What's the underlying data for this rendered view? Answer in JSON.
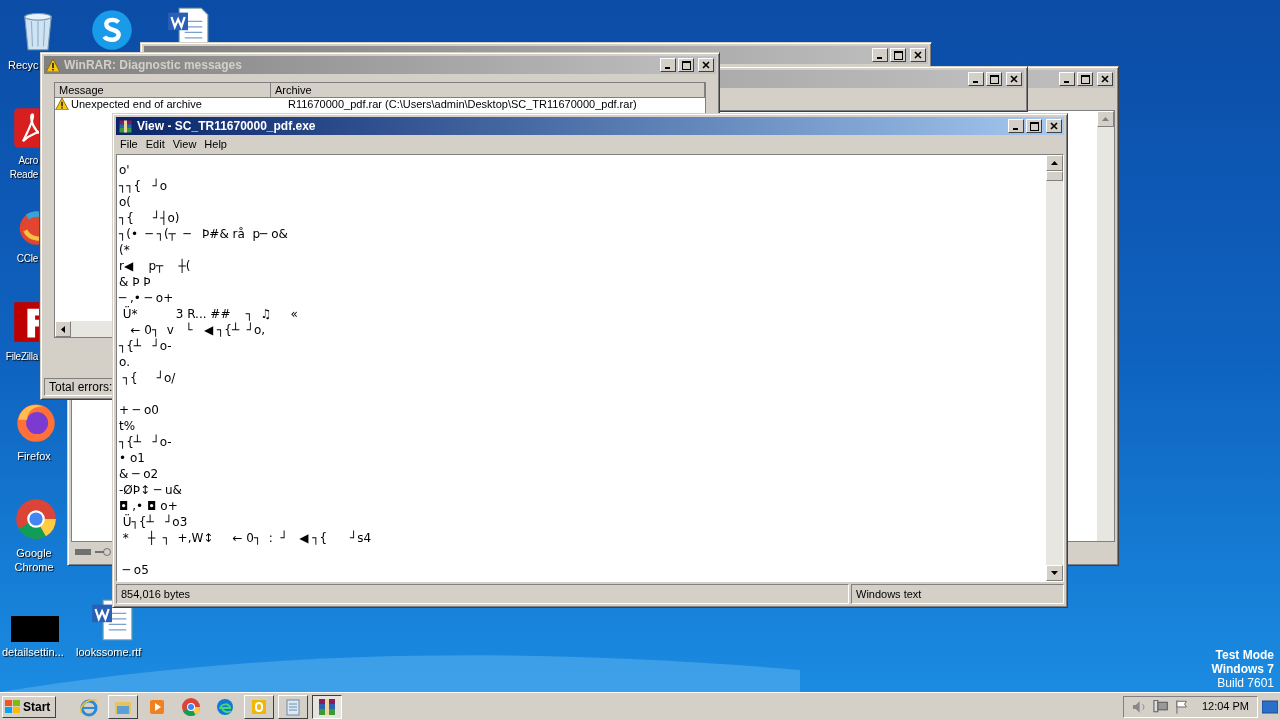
{
  "desktop": {
    "icons": [
      {
        "kind": "recycle-bin",
        "label": "Recyc"
      },
      {
        "kind": "skype"
      },
      {
        "kind": "word"
      },
      {
        "kind": "acrobat",
        "label": "Acro\nReade"
      },
      {
        "kind": "ccleaner",
        "label": "CCle"
      },
      {
        "kind": "filezilla",
        "label": "FileZilla"
      },
      {
        "kind": "firefox",
        "label": "Firefox"
      },
      {
        "kind": "chrome",
        "label": "Google\nChrome"
      },
      {
        "kind": "black-thumb",
        "label": "detailsettin..."
      },
      {
        "kind": "word",
        "label": "lookssome.rtf"
      }
    ],
    "os_notice": [
      "Test Mode",
      "Windows 7",
      "Build 7601"
    ]
  },
  "diagnostic_window": {
    "title": "WinRAR: Diagnostic messages",
    "active": false,
    "columns": [
      "Message",
      "Archive"
    ],
    "rows": [
      {
        "message": "Unexpected end of archive",
        "archive": "R11670000_pdf.rar (C:\\Users\\admin\\Desktop\\SC_TR11670000_pdf.rar)"
      }
    ],
    "status": "Total errors:"
  },
  "viewer_window": {
    "title": "View - SC_TR11670000_pdf.exe",
    "active": true,
    "menu": [
      "File",
      "Edit",
      "View",
      "Help"
    ],
    "lines": [
      {
        "kind": "text",
        "text": "o'"
      },
      {
        "kind": "text",
        "text": "┐┐{   ┘o"
      },
      {
        "kind": "text",
        "text": "o("
      },
      {
        "kind": "text",
        "text": "┐{     ┘┤o)"
      },
      {
        "kind": "text",
        "text": "┐(•  ─ ┐(┬  ─   Þ#& rå  p─ o&"
      },
      {
        "kind": "text",
        "text": "(*"
      },
      {
        "kind": "text",
        "text": "r◀    p┬    ┼("
      },
      {
        "kind": "text",
        "text": "& Þ Þ"
      },
      {
        "kind": "text",
        "text": "─ ,• ─ o+"
      },
      {
        "kind": "text",
        "text": " Ü*          3 R... ##    ┐  ♫     «"
      },
      {
        "kind": "text",
        "text": "   ← 0┐  v   └   ◀ ┐{┴  ┘o,"
      },
      {
        "kind": "text",
        "text": "┐{┴   ┘o-"
      },
      {
        "kind": "text",
        "text": "o."
      },
      {
        "kind": "text",
        "text": " ┐{     ┘o/"
      },
      {
        "kind": "blank"
      },
      {
        "kind": "text",
        "text": "+ ─ o0"
      },
      {
        "kind": "text",
        "text": "t%"
      },
      {
        "kind": "text",
        "text": "┐{┴   ┘o-"
      },
      {
        "kind": "text",
        "text": "• o1"
      },
      {
        "kind": "text",
        "text": "& ─ o2"
      },
      {
        "kind": "text",
        "text": "-ØÞ↕ ─ u&"
      },
      {
        "kind": "text",
        "text": "◘ ,• ◘ o+"
      },
      {
        "kind": "text",
        "text": " Ü┐{┴   ┘o3"
      },
      {
        "kind": "text",
        "text": " *     ┼  ┐  +,W↕     ← 0┐  :  ┘   ◀ ┐{      ┘s4"
      },
      {
        "kind": "blank"
      },
      {
        "kind": "text",
        "text": " ─ o5"
      }
    ],
    "status": [
      "854,016 bytes",
      "Windows text"
    ]
  },
  "taskbar": {
    "start": "Start",
    "apps": [
      {
        "kind": "ie",
        "open": false,
        "selected": false
      },
      {
        "kind": "explorer",
        "open": true,
        "selected": false
      },
      {
        "kind": "media-player",
        "open": false,
        "selected": false
      },
      {
        "kind": "chrome",
        "open": false,
        "selected": false
      },
      {
        "kind": "edge",
        "open": false,
        "selected": false
      },
      {
        "kind": "outlook",
        "open": true,
        "selected": false
      },
      {
        "kind": "notepad",
        "open": true,
        "selected": false
      },
      {
        "kind": "winrar",
        "open": true,
        "selected": true
      }
    ],
    "clock": "12:04 PM"
  }
}
